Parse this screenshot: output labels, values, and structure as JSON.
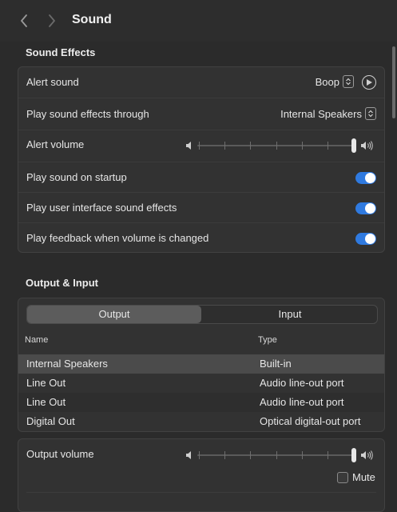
{
  "header": {
    "title": "Sound",
    "back_icon": "chevron-left-icon",
    "forward_icon": "chevron-right-icon"
  },
  "sound_effects": {
    "title": "Sound Effects",
    "alert_sound": {
      "label": "Alert sound",
      "value": "Boop"
    },
    "play_through": {
      "label": "Play sound effects through",
      "value": "Internal Speakers"
    },
    "alert_volume": {
      "label": "Alert volume",
      "level": 1.0
    },
    "toggles": [
      {
        "label": "Play sound on startup",
        "on": true
      },
      {
        "label": "Play user interface sound effects",
        "on": true
      },
      {
        "label": "Play feedback when volume is changed",
        "on": true
      }
    ]
  },
  "output_input": {
    "title": "Output & Input",
    "tabs": [
      {
        "label": "Output",
        "selected": true
      },
      {
        "label": "Input",
        "selected": false
      }
    ],
    "columns": {
      "name": "Name",
      "type": "Type"
    },
    "devices": [
      {
        "name": "Internal Speakers",
        "type": "Built-in",
        "selected": true
      },
      {
        "name": "Line Out",
        "type": "Audio line-out port",
        "selected": false
      },
      {
        "name": "Line Out",
        "type": "Audio line-out port",
        "selected": false
      },
      {
        "name": "Digital Out",
        "type": "Optical digital-out port",
        "selected": false
      }
    ]
  },
  "output_volume": {
    "label": "Output volume",
    "level": 1.0,
    "mute_label": "Mute",
    "muted": false
  },
  "colors": {
    "accent": "#2f7ae0",
    "background": "#2b2b2b",
    "group": "#323232"
  }
}
